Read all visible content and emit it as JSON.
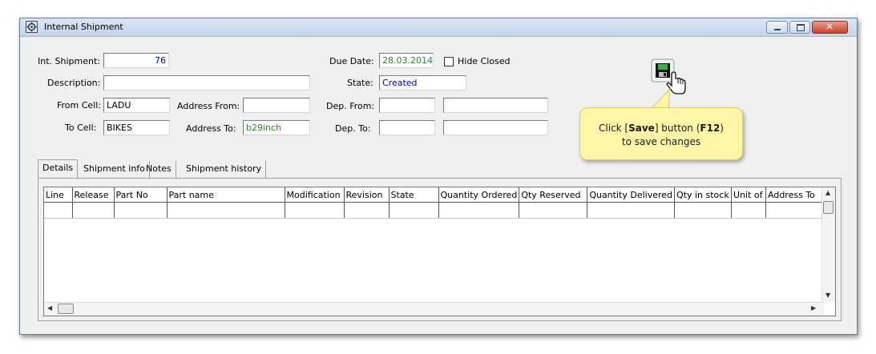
{
  "window": {
    "title": "Internal Shipment",
    "controls": {
      "minimize_icon": "minimize-icon",
      "maximize_icon": "maximize-icon",
      "close_glyph": "✕"
    }
  },
  "form": {
    "int_shipment": {
      "label": "Int. Shipment:",
      "value": "76"
    },
    "description": {
      "label": "Description:",
      "value": ""
    },
    "from_cell": {
      "label": "From Cell:",
      "value": "LADU"
    },
    "to_cell": {
      "label": "To Cell:",
      "value": "BIKES"
    },
    "address_from": {
      "label": "Address From:",
      "value": ""
    },
    "address_to": {
      "label": "Address To:",
      "value": "b29inch"
    },
    "due_date": {
      "label": "Due Date:",
      "value": "28.03.2014"
    },
    "hide_closed": {
      "label": "Hide Closed",
      "checked": false
    },
    "state": {
      "label": "State:",
      "value": "Created"
    },
    "dep_from": {
      "label": "Dep. From:",
      "code": "",
      "name": ""
    },
    "dep_to": {
      "label": "Dep. To:",
      "code": "",
      "name": ""
    }
  },
  "callout": {
    "line1_pre": "Click [",
    "line1_bold": "Save",
    "line1_mid": "] button (",
    "line1_key": "F12",
    "line1_post": ")",
    "line2": "to save changes"
  },
  "tabs": [
    {
      "label": "Details",
      "active": true
    },
    {
      "label": "Shipment info",
      "active": false
    },
    {
      "label": "Notes",
      "active": false
    },
    {
      "label": "Shipment history",
      "active": false
    }
  ],
  "grid": {
    "columns": [
      "Line",
      "Release",
      "Part No",
      "Part name",
      "Modification",
      "Revision",
      "State",
      "Quantity Ordered",
      "Qty Reserved",
      "Quantity Delivered",
      "Qty in stock",
      "Unit of",
      "Address To"
    ],
    "rows": []
  },
  "scroll": {
    "up": "▲",
    "down": "▼",
    "left": "◀",
    "right": "▶"
  }
}
